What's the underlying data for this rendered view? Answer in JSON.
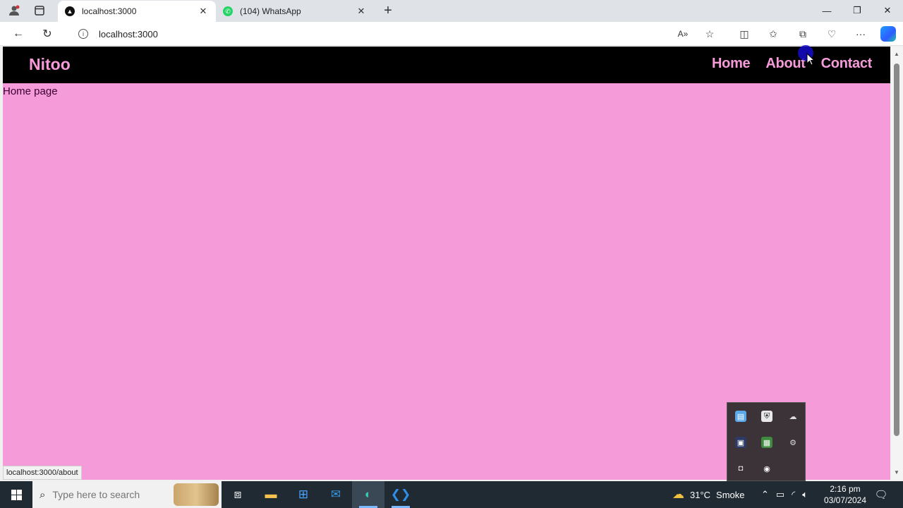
{
  "browser": {
    "tabs": [
      {
        "label": "localhost:3000",
        "active": true
      },
      {
        "label": "(104) WhatsApp",
        "active": false
      }
    ],
    "new_tab_symbol": "+",
    "address": "localhost:3000",
    "status_url": "localhost:3000/about"
  },
  "page": {
    "brand": "Nitoo",
    "nav": [
      {
        "label": "Home"
      },
      {
        "label": "About"
      },
      {
        "label": "Contact"
      }
    ],
    "body_text": "Home page",
    "colors": {
      "background": "#f59bd9",
      "navbar": "#000000",
      "accent": "#f59bd9"
    }
  },
  "taskbar": {
    "search_placeholder": "Type here to search",
    "weather": {
      "temp": "31°C",
      "condition": "Smoke"
    },
    "time": "2:16 pm",
    "date": "03/07/2024"
  },
  "icons": {
    "profile": "profile-icon",
    "tab_actions": "tab-actions-icon",
    "back": "back-arrow-icon",
    "refresh": "refresh-icon",
    "info": "info-icon",
    "read_aloud": "read-aloud-icon",
    "favorite": "star-icon",
    "split": "split-screen-icon",
    "favorites": "favorites-icon",
    "collections": "collections-icon",
    "browser_essentials": "heart-pulse-icon",
    "more": "more-icon"
  }
}
